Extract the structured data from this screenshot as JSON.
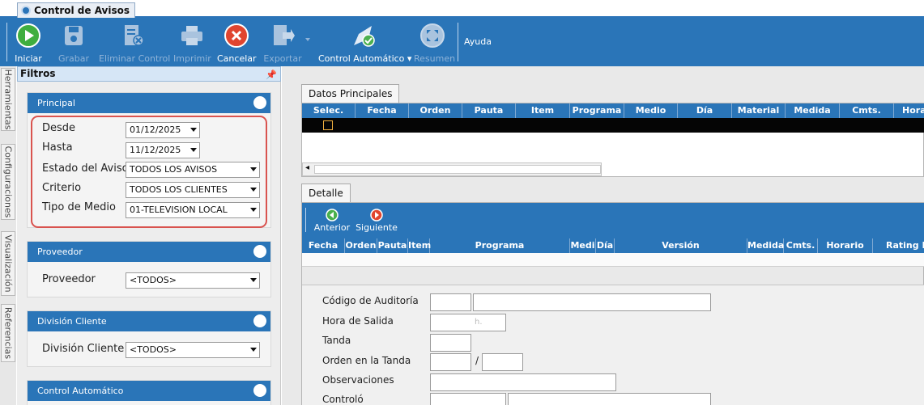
{
  "window": {
    "tab_title": "Control de Avisos"
  },
  "toolbar": {
    "buttons": [
      {
        "label": "Iniciar",
        "icon": "play-icon",
        "enabled": true
      },
      {
        "label": "Grabar",
        "icon": "floppy-disk-icon",
        "enabled": false
      },
      {
        "label": "Eliminar Control",
        "icon": "delete-document-icon",
        "enabled": false
      },
      {
        "label": "Imprimir",
        "icon": "printer-icon",
        "enabled": false
      },
      {
        "label": "Cancelar",
        "icon": "cancel-icon",
        "enabled": true
      },
      {
        "label": "Exportar",
        "icon": "export-icon",
        "enabled": false
      },
      {
        "label": "Control Automático",
        "icon": "auto-control-icon",
        "enabled": true
      },
      {
        "label": "Resumen",
        "icon": "summary-icon",
        "enabled": false
      }
    ],
    "help_label": "Ayuda"
  },
  "side_tabs": [
    "Herramientas",
    "Configuraciones",
    "Visualización",
    "Referencias"
  ],
  "filters": {
    "title": "Filtros",
    "principal": {
      "title": "Principal",
      "fields": [
        {
          "label": "Desde",
          "value": "01/12/2025"
        },
        {
          "label": "Hasta",
          "value": "11/12/2025"
        },
        {
          "label": "Estado del Aviso",
          "value": "TODOS LOS AVISOS"
        },
        {
          "label": "Criterio",
          "value": "TODOS LOS CLIENTES"
        },
        {
          "label": "Tipo de Medio",
          "value": "01-TELEVISION LOCAL"
        }
      ]
    },
    "proveedor": {
      "title": "Proveedor",
      "label": "Proveedor",
      "value": "<TODOS>"
    },
    "division": {
      "title": "División Cliente",
      "label": "División Cliente",
      "value": "<TODOS>"
    },
    "control_auto": {
      "title": "Control Automático"
    }
  },
  "datos_principales": {
    "tab": "Datos Principales",
    "columns": [
      "Selec.",
      "Fecha",
      "Orden",
      "Pauta",
      "Item",
      "Programa",
      "Medio",
      "Día",
      "Material",
      "Medida",
      "Cmts.",
      "Hora"
    ]
  },
  "detalle": {
    "tab": "Detalle",
    "nav": {
      "prev": "Anterior",
      "next": "Siguiente"
    },
    "columns": [
      "Fecha",
      "Orden",
      "Pauta",
      "Item",
      "Programa",
      "Medi",
      "Día",
      "Versión",
      "Medida",
      "Cmts.",
      "Horario",
      "Rating P"
    ],
    "form": {
      "codigo": "Código de Auditoría",
      "hora_salida": "Hora de Salida",
      "tanda": "Tanda",
      "orden_tanda": "Orden en la Tanda",
      "observaciones": "Observaciones",
      "controlo": "Controló",
      "slash": "/",
      "hora_hint": "h."
    }
  }
}
